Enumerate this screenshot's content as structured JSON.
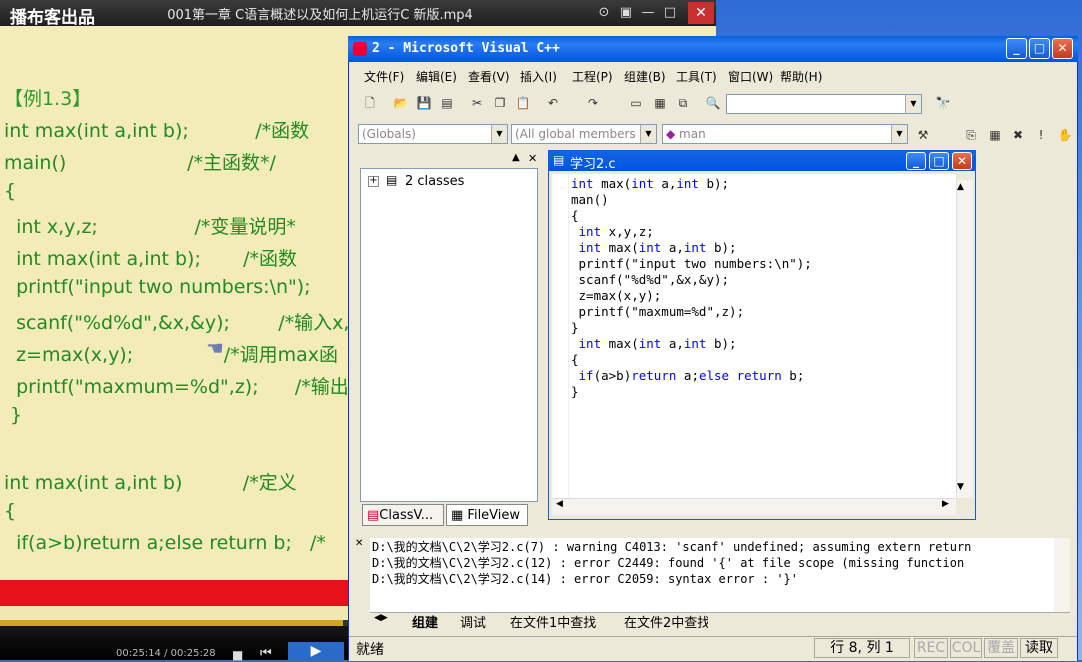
{
  "player": {
    "title": "001第一章 C语言概述以及如何上机运行C 新版.mp4",
    "close": "✕",
    "lines": [
      "【例1.3】",
      "int max(int a,int b);           /*函数",
      "main()                    /*主函数*/",
      "{",
      "  int x,y,z;                /*变量说明*",
      "  int max(int a,int b);       /*函数",
      "  printf(\"input two numbers:\\n\");",
      "  scanf(\"%d%d\",&x,&y);        /*输入x,y",
      "  z=max(x,y);               /*调用max函",
      "  printf(\"maxmum=%d\",z);      /*输出*/",
      " }",
      "",
      "int max(int a,int b)          /*定义",
      "{",
      "  if(a>b)return a;else return b;   /*"
    ],
    "brand": "播布客出品",
    "time": "00:25:14 / 00:25:28",
    "progress": 0.98
  },
  "vc": {
    "title": "2 - Microsoft Visual C++",
    "menu": [
      "文件(F)",
      "编辑(E)",
      "查看(V)",
      "插入(I)",
      "工程(P)",
      "组建(B)",
      "工具(T)",
      "窗口(W)",
      "帮助(H)"
    ],
    "combo_globals": "(Globals)",
    "combo_members": "(All global members",
    "combo_func": "man",
    "tree_root": "2 classes",
    "tab_class": "ClassV...",
    "tab_file": "FileView",
    "editor_title": "学习2.c",
    "code": [
      "int max(int a,int b);",
      "man()",
      "{",
      " int x,y,z;",
      " int max(int a,int b);",
      " printf(\"input two numbers:\\n\");",
      " scanf(\"%d%d\",&x,&y);",
      " z=max(x,y);",
      " printf(\"maxmum=%d\",z);",
      "}",
      " int max(int a,int b);",
      "{",
      " if(a>b)return a;else return b;",
      "}"
    ],
    "output": [
      "D:\\我的文档\\C\\2\\学习2.c(7) : warning C4013: 'scanf' undefined; assuming extern return",
      "D:\\我的文档\\C\\2\\学习2.c(12) : error C2449: found '{' at file scope (missing function",
      "D:\\我的文档\\C\\2\\学习2.c(14) : error C2059: syntax error : '}'"
    ],
    "output_tabs": [
      "组建",
      "调试",
      "在文件1中查找",
      "在文件2中查找"
    ],
    "status": "就绪",
    "position": "行 8, 列 1",
    "rec": "REC",
    "col": "COL",
    "ovr": "覆盖",
    "read": "读取"
  },
  "colors": {
    "xp_blue": "#0054e3",
    "keyword": "#0000ff",
    "chalk_green": "#228b22",
    "banner_red": "#e8101a"
  }
}
